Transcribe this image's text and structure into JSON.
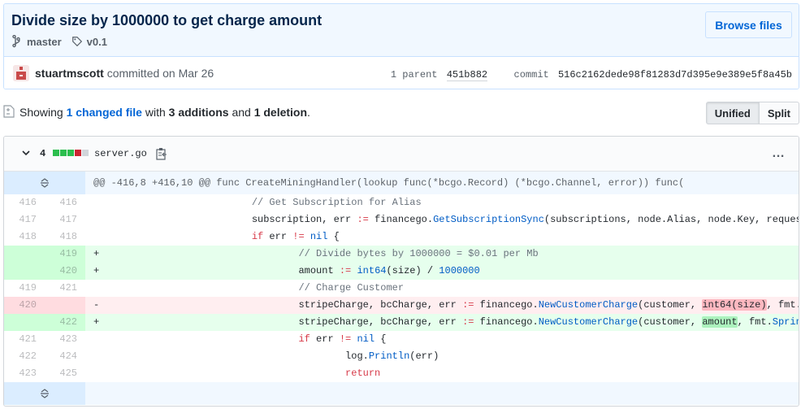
{
  "commit": {
    "title": "Divide size by 1000000 to get charge amount",
    "branch": "master",
    "tag": "v0.1",
    "browse_label": "Browse files",
    "author": "stuartmscott",
    "committed_text": "committed on Mar 26",
    "parent_label": "1 parent",
    "parent_sha": "451b882",
    "commit_label": "commit",
    "commit_sha": "516c2162dede98f81283d7d395e9e389e5f8a45b"
  },
  "toolbar": {
    "showing": "Showing",
    "changed_files": "1 changed file",
    "with": "with",
    "additions": "3 additions",
    "and": "and",
    "deletions": "1 deletion",
    "period": ".",
    "unified_label": "Unified",
    "split_label": "Split"
  },
  "file": {
    "changes": "4",
    "name": "server.go",
    "more": "…",
    "hunk_header": "@@ -416,8 +416,10 @@ func CreateMiningHandler(lookup func(*bcgo.Record) (*bcgo.Channel, error)) func(",
    "lines": [
      {
        "type": "ctx",
        "old": "416",
        "new": "416",
        "indent": "                        ",
        "segments": [
          {
            "t": "// Get Subscription for Alias",
            "c": "c-com"
          }
        ]
      },
      {
        "type": "ctx",
        "old": "417",
        "new": "417",
        "indent": "                        ",
        "segments": [
          {
            "t": "subscription, err ",
            "c": ""
          },
          {
            "t": ":=",
            "c": "c-kw"
          },
          {
            "t": " financego.",
            "c": ""
          },
          {
            "t": "GetSubscriptionSync",
            "c": "c-fn"
          },
          {
            "t": "(subscriptions, node.Alias, node.Key, reques",
            "c": ""
          }
        ]
      },
      {
        "type": "ctx",
        "old": "418",
        "new": "418",
        "indent": "                        ",
        "segments": [
          {
            "t": "if",
            "c": "c-kw"
          },
          {
            "t": " err ",
            "c": ""
          },
          {
            "t": "!=",
            "c": "c-kw"
          },
          {
            "t": " ",
            "c": ""
          },
          {
            "t": "nil",
            "c": "c-fn"
          },
          {
            "t": " {",
            "c": ""
          }
        ]
      },
      {
        "type": "add",
        "old": "",
        "new": "419",
        "indent": "                                ",
        "segments": [
          {
            "t": "// Divide bytes by 1000000 = $0.01 per Mb",
            "c": "c-com"
          }
        ]
      },
      {
        "type": "add",
        "old": "",
        "new": "420",
        "indent": "                                ",
        "segments": [
          {
            "t": "amount ",
            "c": ""
          },
          {
            "t": ":=",
            "c": "c-kw"
          },
          {
            "t": " ",
            "c": ""
          },
          {
            "t": "int64",
            "c": "c-fn"
          },
          {
            "t": "(size) / ",
            "c": ""
          },
          {
            "t": "1000000",
            "c": "c-num"
          }
        ]
      },
      {
        "type": "ctx",
        "old": "419",
        "new": "421",
        "indent": "                                ",
        "segments": [
          {
            "t": "// Charge Customer",
            "c": "c-com"
          }
        ]
      },
      {
        "type": "del",
        "old": "420",
        "new": "",
        "indent": "                                ",
        "segments": [
          {
            "t": "stripeCharge, bcCharge, err ",
            "c": ""
          },
          {
            "t": ":=",
            "c": "c-kw"
          },
          {
            "t": " financego.",
            "c": ""
          },
          {
            "t": "NewCustomerCharge",
            "c": "c-fn"
          },
          {
            "t": "(customer, ",
            "c": ""
          },
          {
            "t": "int64(size)",
            "c": "hl-del"
          },
          {
            "t": ", fmt.",
            "c": ""
          }
        ]
      },
      {
        "type": "add",
        "old": "",
        "new": "422",
        "indent": "                                ",
        "segments": [
          {
            "t": "stripeCharge, bcCharge, err ",
            "c": ""
          },
          {
            "t": ":=",
            "c": "c-kw"
          },
          {
            "t": " financego.",
            "c": ""
          },
          {
            "t": "NewCustomerCharge",
            "c": "c-fn"
          },
          {
            "t": "(customer, ",
            "c": ""
          },
          {
            "t": "amount",
            "c": "hl-add"
          },
          {
            "t": ", fmt.",
            "c": ""
          },
          {
            "t": "Sprin",
            "c": "c-fn"
          }
        ]
      },
      {
        "type": "ctx",
        "old": "421",
        "new": "423",
        "indent": "                                ",
        "segments": [
          {
            "t": "if",
            "c": "c-kw"
          },
          {
            "t": " err ",
            "c": ""
          },
          {
            "t": "!=",
            "c": "c-kw"
          },
          {
            "t": " ",
            "c": ""
          },
          {
            "t": "nil",
            "c": "c-fn"
          },
          {
            "t": " {",
            "c": ""
          }
        ]
      },
      {
        "type": "ctx",
        "old": "422",
        "new": "424",
        "indent": "                                        ",
        "segments": [
          {
            "t": "log.",
            "c": ""
          },
          {
            "t": "Println",
            "c": "c-fn"
          },
          {
            "t": "(err)",
            "c": ""
          }
        ]
      },
      {
        "type": "ctx",
        "old": "423",
        "new": "425",
        "indent": "                                        ",
        "segments": [
          {
            "t": "return",
            "c": "c-kw"
          }
        ]
      }
    ]
  },
  "colors": {
    "accent": "#0366d6",
    "add_bg": "#e6ffed",
    "del_bg": "#ffeef0",
    "diffstat_add": "#2cbe4e",
    "diffstat_del": "#cb2431",
    "diffstat_neutral": "#d1d5da"
  },
  "icons": {
    "branch": "git-branch-icon",
    "tag": "tag-icon",
    "copy": "clipboard-icon",
    "chevron": "chevron-down-icon",
    "expand": "unfold-icon",
    "toc": "file-diff-icon"
  }
}
